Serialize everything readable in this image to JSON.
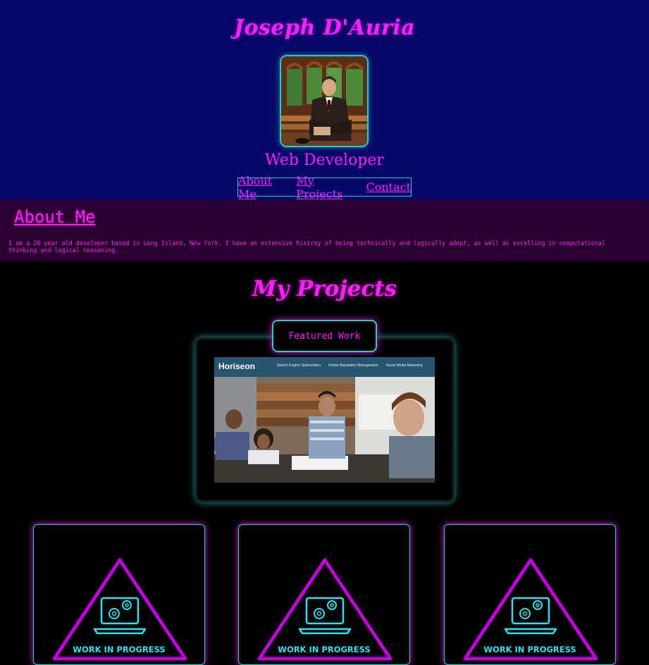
{
  "header": {
    "name": "Joseph D'Auria",
    "title": "Web Developer",
    "nav": [
      {
        "label": "About Me"
      },
      {
        "label": "My Projects"
      },
      {
        "label": "Contact"
      }
    ]
  },
  "about": {
    "heading": "About Me",
    "text": "I am a 26 year old developer based in Long Island, New York. I have an extensive histroy of being technically and logically adept, as well as excelling in computational thinking and logical reasoning."
  },
  "projects": {
    "heading": "My Projects",
    "featured": {
      "label": "Featured Work",
      "preview": {
        "brand": "Horiseon",
        "links": [
          "Search Engine Optimization",
          "Online Reputation Management",
          "Social Media Marketing"
        ]
      }
    },
    "work_in_progress": [
      {
        "label": "WORK IN PROGRESS"
      },
      {
        "label": "WORK IN PROGRESS"
      },
      {
        "label": "WORK IN PROGRESS"
      }
    ]
  },
  "colors": {
    "header_bg": "#050866",
    "accent_pink": "#ff1fff",
    "accent_cyan": "#1fd0d0",
    "about_bg": "#29002e",
    "page_bg": "#000000"
  }
}
